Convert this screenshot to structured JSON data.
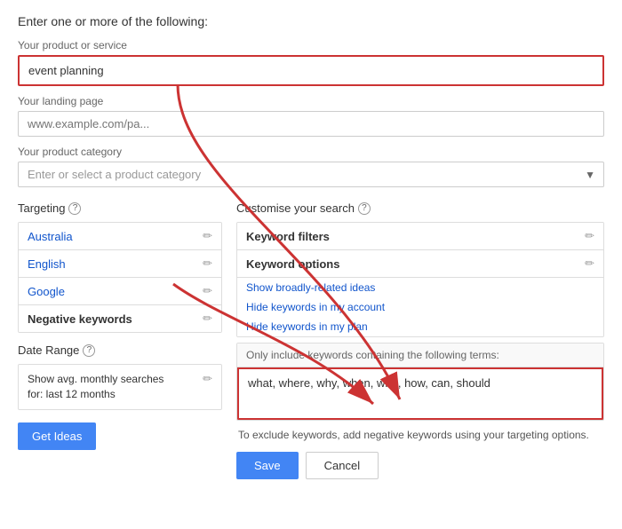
{
  "header": {
    "instruction": "Enter one or more of the following:"
  },
  "product_section": {
    "label": "Your product or service",
    "value": "event planning",
    "placeholder": "Your product or service"
  },
  "landing_page": {
    "label": "Your landing page",
    "placeholder": "www.example.com/pa..."
  },
  "product_category": {
    "label": "Your product category",
    "placeholder": "Enter or select a product category"
  },
  "targeting": {
    "title": "Targeting",
    "help": "?",
    "items": [
      {
        "label": "Australia",
        "bold": false
      },
      {
        "label": "English",
        "bold": false
      },
      {
        "label": "Google",
        "bold": false
      },
      {
        "label": "Negative keywords",
        "bold": true
      }
    ]
  },
  "date_range": {
    "title": "Date Range",
    "help": "?",
    "text_line1": "Show avg. monthly searches",
    "text_line2": "for: last 12 months"
  },
  "get_ideas_button": "Get Ideas",
  "customise": {
    "title": "Customise your search",
    "help": "?"
  },
  "keyword_filters": {
    "title": "Keyword filters",
    "edit_icon": "✎"
  },
  "keyword_options": {
    "title": "Keyword options",
    "edit_icon": "✎",
    "items": [
      "Show broadly-related ideas",
      "Hide keywords in my account",
      "Hide keywords in my plan"
    ]
  },
  "include_keywords": {
    "header": "Only include keywords containing the following terms:",
    "value": "what, where, why, when, who, how, can, should"
  },
  "exclude_info": "To exclude keywords, add negative keywords using your targeting options.",
  "save_button": "Save",
  "cancel_button": "Cancel"
}
